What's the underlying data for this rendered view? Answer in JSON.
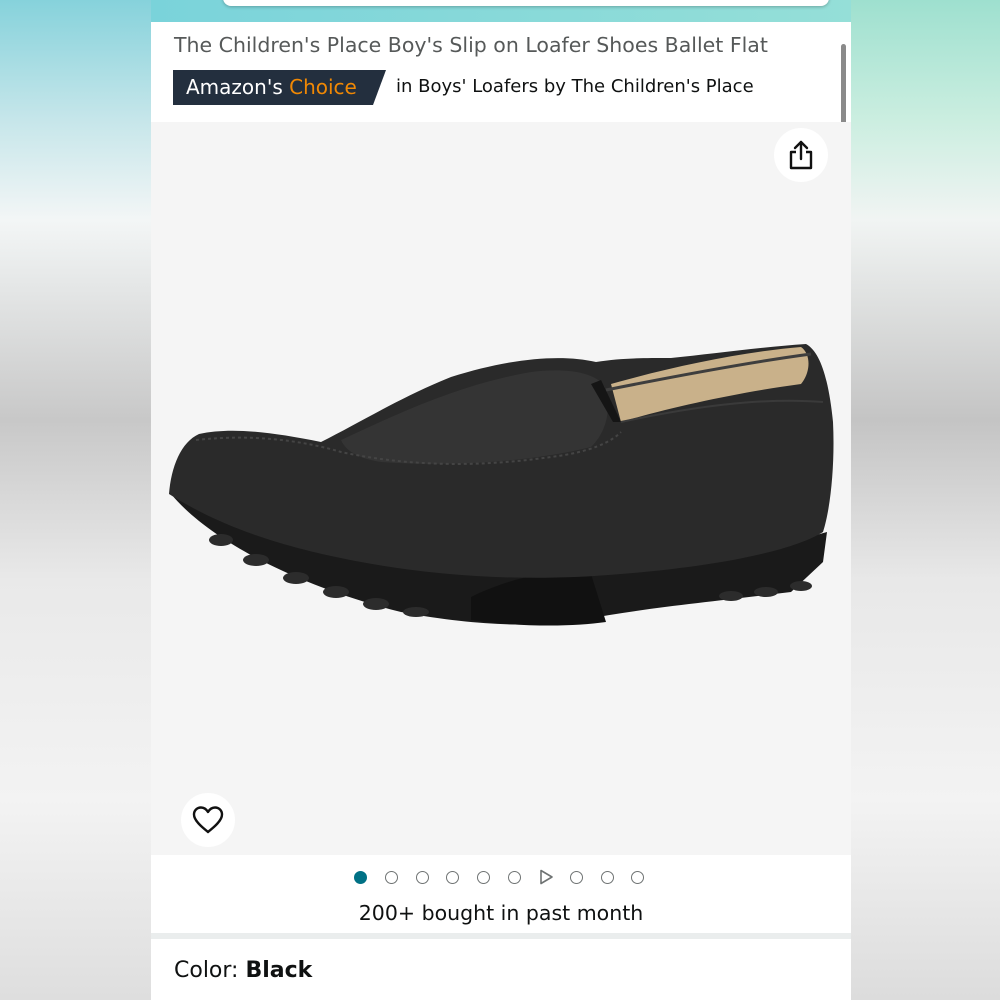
{
  "product": {
    "title": "The Children's Place Boy's Slip on Loafer Shoes Ballet Flat",
    "badge": {
      "prefix": "Amazon's",
      "accent": "Choice",
      "context": "in Boys' Loafers by The Children's Place"
    },
    "bought_text": "200+ bought in past month",
    "color": {
      "label": "Color:",
      "value": "Black"
    }
  },
  "gallery": {
    "image_description_icon": "shoe-image",
    "dot_count": 10,
    "active_index": 0,
    "video_index": 6
  },
  "icons": {
    "share": "share-icon",
    "wishlist": "heart-icon",
    "video": "play-icon"
  },
  "colors": {
    "badge_bg": "#232f3e",
    "badge_accent": "#f08804",
    "active_dot": "#007185",
    "text": "#0f1111",
    "title_text": "#565959"
  }
}
